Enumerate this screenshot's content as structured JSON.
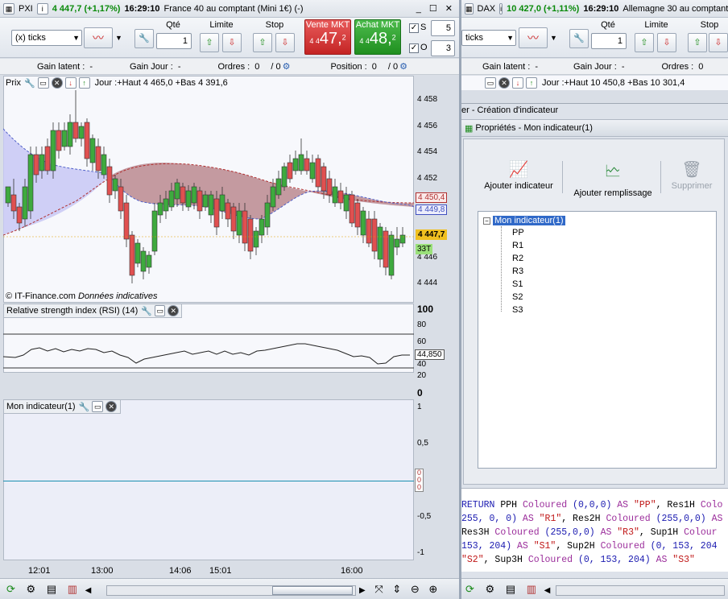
{
  "left": {
    "title": {
      "symbol": "PXI",
      "price": "4 447,7 (+1,17%)",
      "time": "16:29:10",
      "name": "France 40 au comptant (Mini 1€) (-)"
    },
    "toolbar": {
      "interval": "(x) ticks",
      "qty_label": "Qté",
      "qty_value": "1",
      "limite_label": "Limite",
      "stop_label": "Stop",
      "vente_label": "Vente MKT",
      "vente_price": "47,",
      "vente_prefix": "4 4",
      "vente_sup": "2",
      "achat_label": "Achat MKT",
      "achat_price": "48,",
      "achat_prefix": "4 4",
      "achat_sup": "2",
      "s_label": "S",
      "s_value": "5",
      "o_label": "O",
      "o_value": "3"
    },
    "info": {
      "gain_latent": "Gain latent :",
      "gain_latent_val": "-",
      "gain_jour": "Gain Jour :",
      "gain_jour_val": "-",
      "ordres": "Ordres :",
      "ordres_val": "0",
      "ordres_val2": "/ 0",
      "position": "Position :",
      "position_val": "0",
      "position_val2": "/ 0"
    },
    "price_panel": {
      "title": "Prix",
      "jour": "Jour :+Haut 4 465,0 +Bas 4 391,6",
      "watermark": "© IT-Finance.com",
      "watermark2": "Données indicatives",
      "current": "4 447,7",
      "red_level": "4 450,4",
      "blue_level": "4 449,8",
      "ticks_badge": "33T",
      "y_labels": [
        "4 458",
        "4 456",
        "4 454",
        "4 452",
        "4 450",
        "4 448",
        "4 446",
        "4 444"
      ]
    },
    "rsi_panel": {
      "title": "Relative strength index (RSI) (14)",
      "value": "44,850",
      "y_labels": [
        "100",
        "80",
        "60",
        "40",
        "20",
        "0"
      ]
    },
    "ind_panel": {
      "title": "Mon indicateur(1)",
      "y_labels": [
        "1",
        "0,5",
        "0",
        "-0,5",
        "-1"
      ],
      "zero_labels": [
        "0",
        "0",
        "0"
      ]
    },
    "x_labels": [
      "12:01",
      "13:00",
      "14:06",
      "15:01",
      "16:00"
    ]
  },
  "right": {
    "title": {
      "symbol": "DAX",
      "price": "10 427,0 (+1,11%)",
      "time": "16:29:10",
      "name": "Allemagne 30 au comptant ("
    },
    "toolbar": {
      "interval": "ticks",
      "qty_label": "Qté",
      "qty_value": "1",
      "limite_label": "Limite",
      "stop_label": "Stop"
    },
    "info": {
      "gain_latent": "Gain latent :",
      "gain_latent_val": "-",
      "gain_jour": "Gain Jour :",
      "gain_jour_val": "-",
      "ordres": "Ordres :",
      "ordres_val": "0"
    },
    "jour": "Jour :+Haut 10 450,8 +Bas 10 301,4",
    "dialog_title": "er - Création d'indicateur",
    "props_title": "Propriétés - Mon indicateur(1)",
    "actions": {
      "add_indicator": "Ajouter indicateur",
      "add_fill": "Ajouter remplissage",
      "delete": "Supprimer"
    },
    "tree": {
      "root": "Mon indicateur(1)",
      "children": [
        "PP",
        "R1",
        "R2",
        "R3",
        "S1",
        "S2",
        "S3"
      ]
    },
    "code_lines": [
      [
        {
          "t": "RETURN",
          "c": "bluekw"
        },
        {
          "t": " PPH ",
          "c": ""
        },
        {
          "t": "Coloured",
          "c": "kw"
        },
        {
          "t": " (0,0,0) ",
          "c": "num"
        },
        {
          "t": "AS",
          "c": "kw"
        },
        {
          "t": " \"PP\"",
          "c": "str"
        },
        {
          "t": ", Res1H ",
          "c": ""
        },
        {
          "t": "Colo",
          "c": "kw"
        }
      ],
      [
        {
          "t": "255, 0, 0) ",
          "c": "num"
        },
        {
          "t": "AS",
          "c": "kw"
        },
        {
          "t": " \"R1\"",
          "c": "str"
        },
        {
          "t": ", Res2H ",
          "c": ""
        },
        {
          "t": "Coloured",
          "c": "kw"
        },
        {
          "t": " (255,0,0) ",
          "c": "num"
        },
        {
          "t": "AS",
          "c": "kw"
        }
      ],
      [
        {
          "t": " Res3H ",
          "c": ""
        },
        {
          "t": "Coloured",
          "c": "kw"
        },
        {
          "t": " (255,0,0) ",
          "c": "num"
        },
        {
          "t": "AS",
          "c": "kw"
        },
        {
          "t": " \"R3\"",
          "c": "str"
        },
        {
          "t": ", Sup1H ",
          "c": ""
        },
        {
          "t": "Colour",
          "c": "kw"
        }
      ],
      [
        {
          "t": " 153, 204) ",
          "c": "num"
        },
        {
          "t": "AS",
          "c": "kw"
        },
        {
          "t": " \"S1\"",
          "c": "str"
        },
        {
          "t": ", Sup2H ",
          "c": ""
        },
        {
          "t": "Coloured",
          "c": "kw"
        },
        {
          "t": " (0, 153, 204",
          "c": "num"
        }
      ],
      [
        {
          "t": "\"S2\"",
          "c": "str"
        },
        {
          "t": ", Sup3H ",
          "c": ""
        },
        {
          "t": "Coloured",
          "c": "kw"
        },
        {
          "t": " (0, 153, 204) ",
          "c": "num"
        },
        {
          "t": "AS",
          "c": "kw"
        },
        {
          "t": " \"S3\"",
          "c": "str"
        }
      ]
    ]
  }
}
